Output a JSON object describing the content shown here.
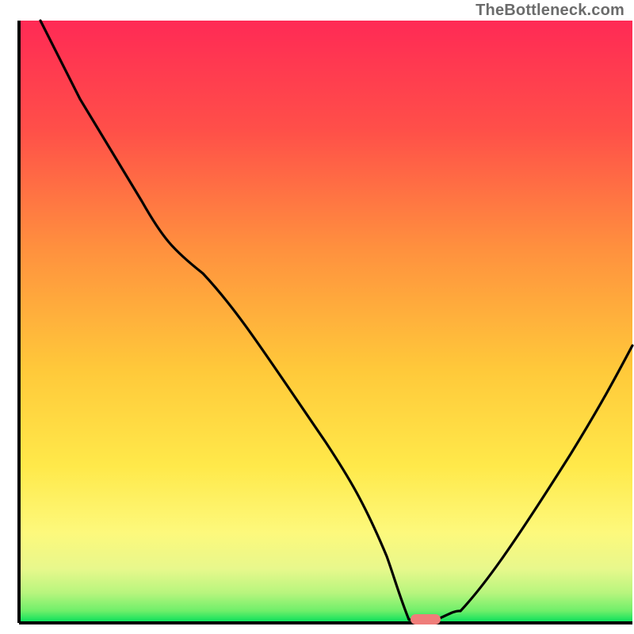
{
  "watermark": "TheBottleneck.com",
  "chart_data": {
    "type": "line",
    "title": "",
    "xlabel": "",
    "ylabel": "",
    "xlim": [
      0,
      100
    ],
    "ylim": [
      0,
      100
    ],
    "grid": false,
    "legend": false,
    "series": [
      {
        "name": "bottleneck-curve",
        "x": [
          3.5,
          10,
          20,
          25,
          30,
          40,
          50,
          55,
          60,
          62,
          65,
          68,
          72,
          80,
          90,
          100
        ],
        "y": [
          100,
          87,
          70,
          62,
          58,
          45,
          30,
          22,
          11,
          4,
          0.5,
          0.5,
          2,
          12,
          28,
          46
        ]
      }
    ],
    "marker": {
      "name": "optimal-point",
      "x": 66,
      "y": 0.6,
      "color": "#ef7d7a"
    },
    "background_gradient": {
      "top": "#ff2a55",
      "mid_upper": "#ff7a3c",
      "mid": "#ffd400",
      "mid_lower": "#fff06a",
      "low": "#dff58a",
      "bottom": "#00e05a"
    },
    "axes_color": "#000000",
    "line_color": "#000000"
  }
}
